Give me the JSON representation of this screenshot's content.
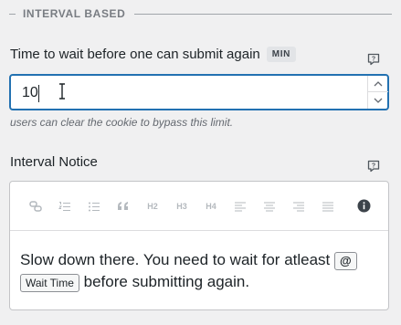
{
  "section": {
    "title": "INTERVAL BASED"
  },
  "wait_field": {
    "label": "Time to wait before one can submit again",
    "unit_badge": "MIN",
    "value": "10",
    "help_text": "users can clear the cookie to bypass this limit."
  },
  "notice_field": {
    "label": "Interval Notice",
    "toolbar": [
      {
        "name": "link-icon"
      },
      {
        "name": "ordered-list-icon"
      },
      {
        "name": "unordered-list-icon"
      },
      {
        "name": "blockquote-icon"
      },
      {
        "label": "H2"
      },
      {
        "label": "H3"
      },
      {
        "label": "H4"
      },
      {
        "name": "align-left-icon"
      },
      {
        "name": "align-center-icon"
      },
      {
        "name": "align-right-icon"
      },
      {
        "name": "align-justify-icon"
      },
      {
        "name": "info-icon"
      }
    ],
    "content_before": "Slow down there. You need to wait for atleast",
    "merge_tag_trigger": "@",
    "merge_tag": "Wait Time",
    "content_after": "before submitting again."
  },
  "colors": {
    "focus_border": "#2271b1",
    "badge_bg": "#e2e4e7",
    "page_bg": "#f0f0f1"
  }
}
